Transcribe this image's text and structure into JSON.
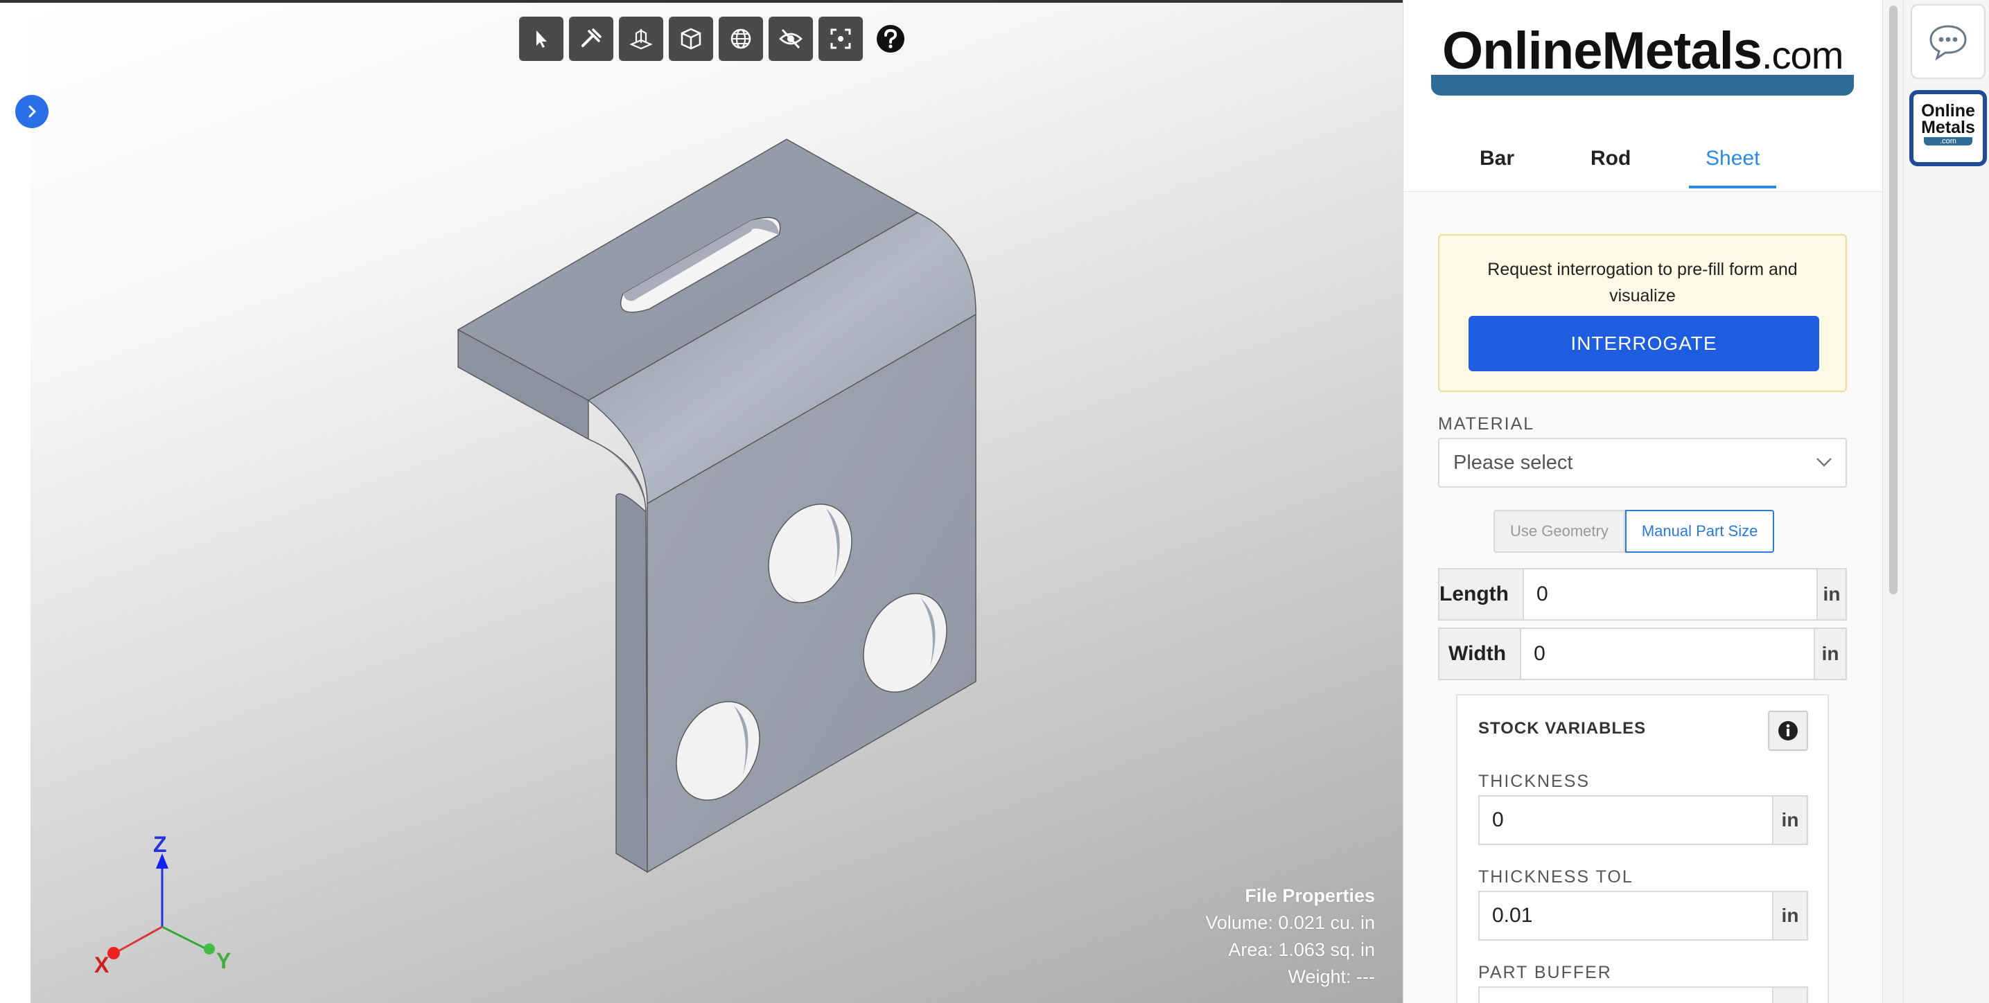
{
  "toolbar": {
    "tools": [
      {
        "name": "select-tool",
        "icon": "cursor-icon"
      },
      {
        "name": "measure-tool",
        "icon": "tools-icon"
      },
      {
        "name": "section-tool",
        "icon": "section-plane-icon"
      },
      {
        "name": "view-cube-tool",
        "icon": "cube-icon"
      },
      {
        "name": "globe-tool",
        "icon": "globe-icon"
      },
      {
        "name": "hide-tool",
        "icon": "eye-slash-icon"
      },
      {
        "name": "fit-view-tool",
        "icon": "focus-frame-icon"
      }
    ],
    "help_icon": "question-circle-icon"
  },
  "axes": {
    "z": "Z",
    "x": "X",
    "y": "Y"
  },
  "file_properties": {
    "title": "File Properties",
    "volume": "Volume: 0.021 cu. in",
    "area": "Area: 1.063 sq. in",
    "weight": "Weight: ---"
  },
  "brand": {
    "name": "OnlineMetals",
    "suffix": ".com",
    "color": "#2f6c95"
  },
  "tabs": [
    {
      "label": "Bar",
      "active": false
    },
    {
      "label": "Rod",
      "active": false
    },
    {
      "label": "Sheet",
      "active": true
    }
  ],
  "interrogate": {
    "message": "Request interrogation to pre-fill form and visualize",
    "button": "INTERROGATE"
  },
  "material": {
    "label": "MATERIAL",
    "placeholder": "Please select"
  },
  "size_mode": {
    "use_geometry": "Use Geometry",
    "manual": "Manual Part Size"
  },
  "dimensions": {
    "length": {
      "label": "Length",
      "value": "0",
      "unit": "in"
    },
    "width": {
      "label": "Width",
      "value": "0",
      "unit": "in"
    }
  },
  "stock": {
    "title": "STOCK VARIABLES",
    "thickness": {
      "label": "THICKNESS",
      "value": "0",
      "unit": "in"
    },
    "thickness_tol": {
      "label": "THICKNESS TOL",
      "value": "0.01",
      "unit": "in"
    },
    "part_buffer": {
      "label": "PART BUFFER"
    }
  },
  "app_rail": {
    "app_line1": "Online",
    "app_line2": "Metals",
    "app_line3": ".com"
  },
  "colors": {
    "accent": "#1f5de0",
    "tab_active": "#2a8ae3",
    "part_face": "#9aa0ae"
  }
}
